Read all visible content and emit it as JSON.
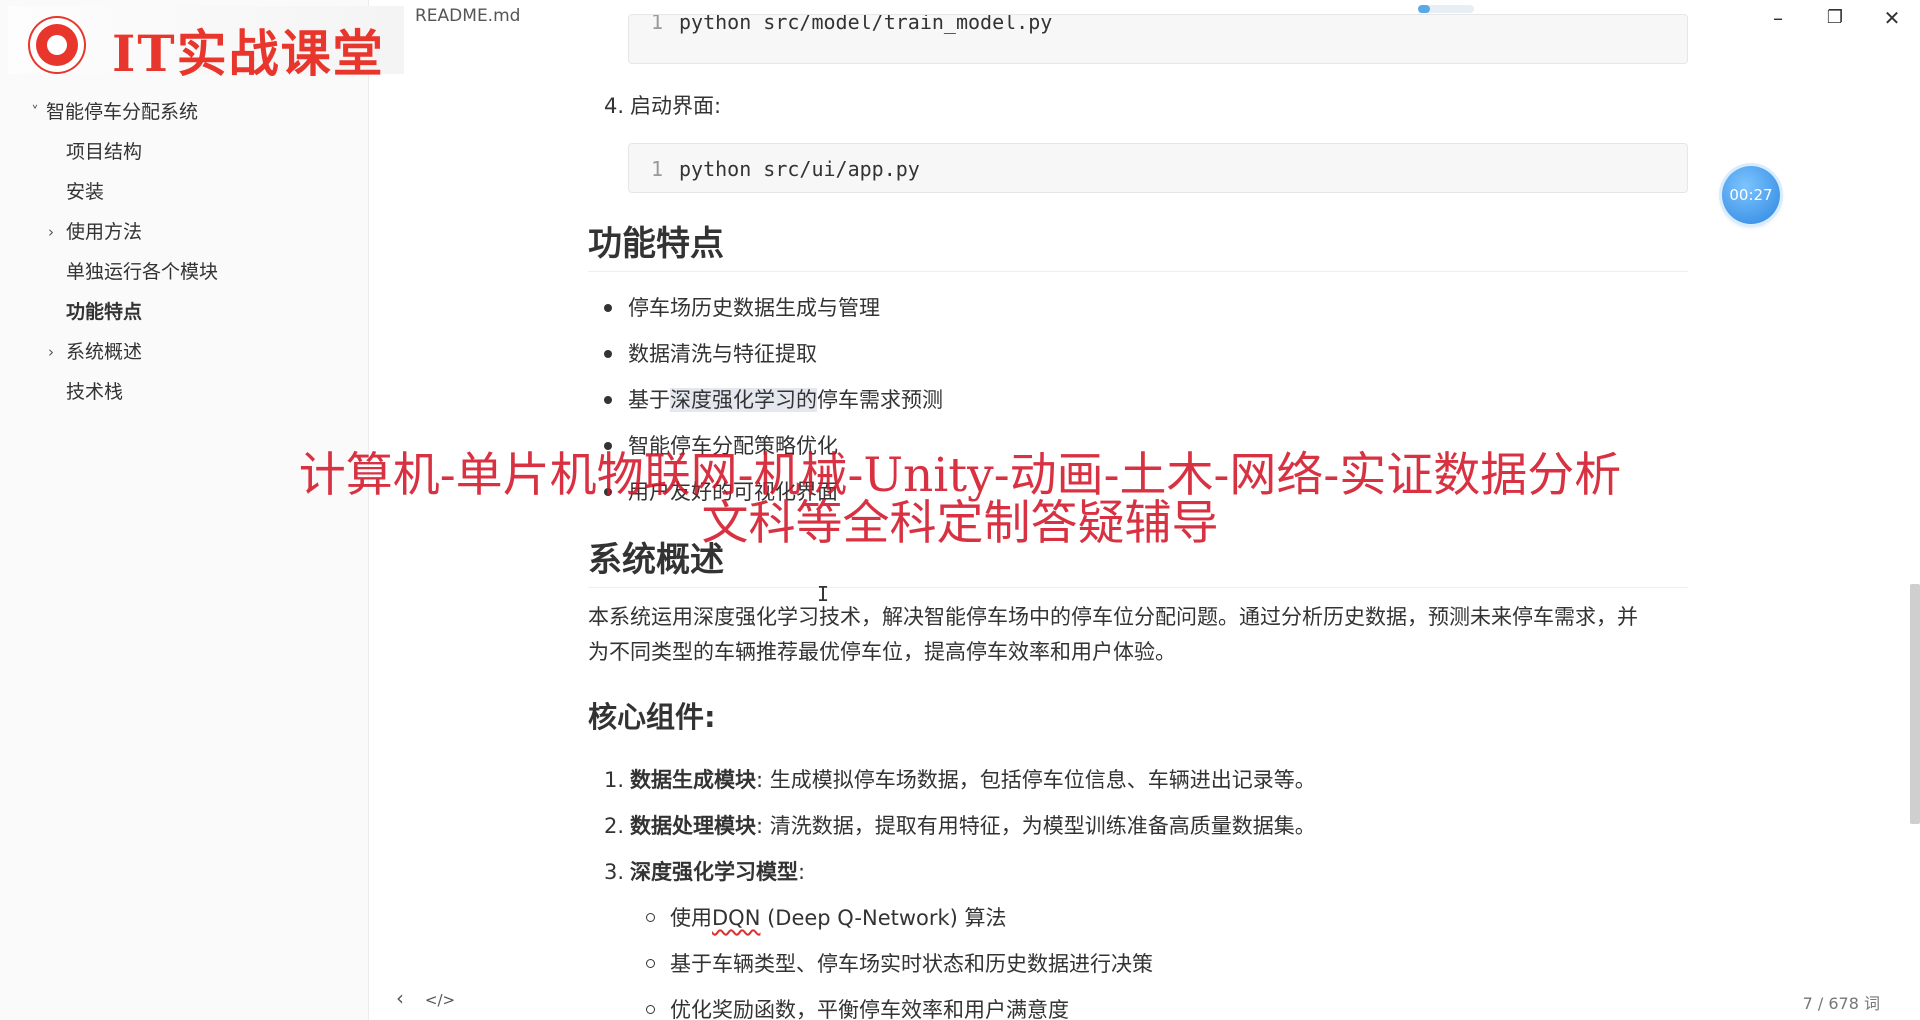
{
  "window": {
    "doc_title": "README.md",
    "minimize_glyph": "–",
    "restore_glyph": "❐",
    "close_glyph": "✕"
  },
  "logo": {
    "text": "IT实战课堂"
  },
  "sidebar": {
    "items": [
      {
        "label": "智能停车分配系统",
        "chevron": "˅",
        "level": 0,
        "bold": false
      },
      {
        "label": "项目结构",
        "chevron": "",
        "level": 1,
        "bold": false
      },
      {
        "label": "安装",
        "chevron": "",
        "level": 1,
        "bold": false
      },
      {
        "label": "使用方法",
        "chevron": "›",
        "level": 1,
        "bold": false
      },
      {
        "label": "单独运行各个模块",
        "chevron": "",
        "level": 1,
        "bold": false
      },
      {
        "label": "功能特点",
        "chevron": "",
        "level": 1,
        "bold": true
      },
      {
        "label": "系统概述",
        "chevron": "›",
        "level": 1,
        "bold": false
      },
      {
        "label": "技术栈",
        "chevron": "",
        "level": 1,
        "bold": false
      }
    ]
  },
  "content": {
    "code_top": {
      "line": "1",
      "code": "python src/model/train_model.py"
    },
    "step4": {
      "num": "4.",
      "text": "启动界面:"
    },
    "code_app": {
      "line": "1",
      "code": "python src/ui/app.py"
    },
    "features_heading": "功能特点",
    "features": [
      "停车场历史数据生成与管理",
      "数据清洗与特征提取",
      "基于深度强化学习的停车需求预测",
      "智能停车分配策略优化",
      "用户友好的可视化界面"
    ],
    "feature3_parts": {
      "pre": "基于",
      "highlight": "深度强化学习的",
      "post": "停车需求预测"
    },
    "overview_heading": "系统概述",
    "overview_text_1": "本系统运用深度强化学习技术，解决智能停车场中的停车位分配问题。通过分析历史数据，预测未来停车需求，并",
    "overview_text_2": "为不同类型的车辆推荐最优停车位，提高停车效率和用户体验。",
    "core_heading": "核心组件:",
    "core": [
      {
        "num": "1.",
        "title": "数据生成模块",
        "desc": ": 生成模拟停车场数据，包括停车位信息、车辆进出记录等。"
      },
      {
        "num": "2.",
        "title": "数据处理模块",
        "desc": ": 清洗数据，提取有用特征，为模型训练准备高质量数据集。"
      },
      {
        "num": "3.",
        "title": "深度强化学习模型",
        "desc": ":"
      }
    ],
    "sub": [
      {
        "pre": "使用",
        "squiggle": "DQN",
        "post": " (Deep Q-Network) 算法"
      },
      {
        "pre": "基于车辆类型、停车场实时状态和历史数据进行决策",
        "squiggle": "",
        "post": ""
      },
      {
        "pre": "优化奖励函数，平衡停车效率和用户满意度",
        "squiggle": "",
        "post": ""
      }
    ]
  },
  "watermark": {
    "line1": "计算机-单片机物联网-机械-Unity-动画-土木-网络-实证数据分析",
    "line2": "文科等全科定制答疑辅导"
  },
  "timer": {
    "text": "00:27"
  },
  "footer": {
    "back_glyph": "‹",
    "source_glyph": "</>",
    "word_count": "7 / 678 词"
  },
  "cursor_glyph": "I"
}
